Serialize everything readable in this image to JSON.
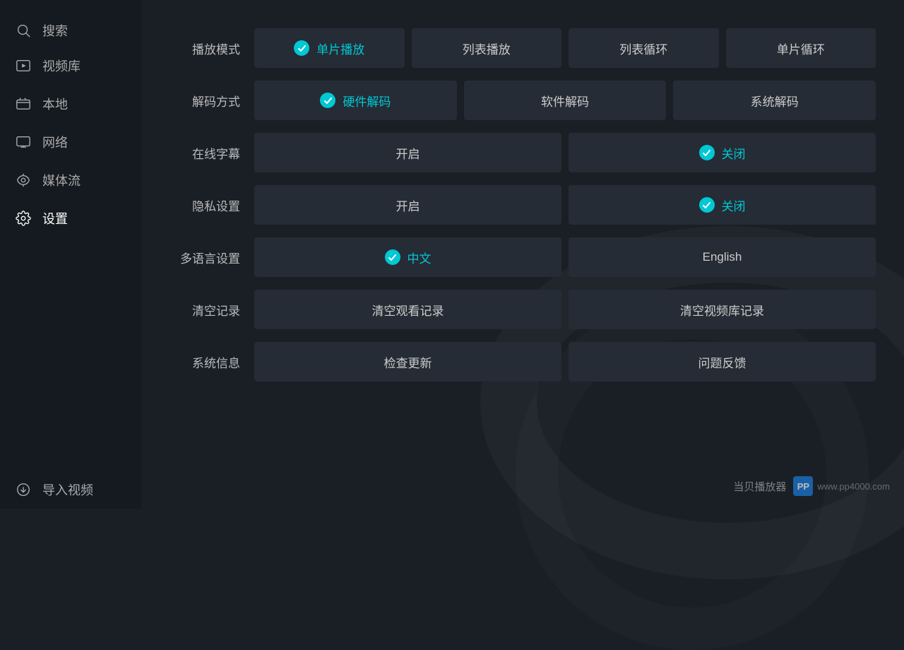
{
  "sidebar": {
    "items": [
      {
        "id": "search",
        "label": "搜索",
        "icon": "search"
      },
      {
        "id": "video-library",
        "label": "视频库",
        "icon": "video-library"
      },
      {
        "id": "local",
        "label": "本地",
        "icon": "local"
      },
      {
        "id": "network",
        "label": "网络",
        "icon": "network"
      },
      {
        "id": "media-stream",
        "label": "媒体流",
        "icon": "media-stream"
      },
      {
        "id": "settings",
        "label": "设置",
        "icon": "settings",
        "active": true
      },
      {
        "id": "import",
        "label": "导入视频",
        "icon": "import"
      }
    ]
  },
  "settings": {
    "playback_mode": {
      "label": "播放模式",
      "options": [
        {
          "id": "single",
          "label": "单片播放",
          "selected": true
        },
        {
          "id": "list",
          "label": "列表播放",
          "selected": false
        },
        {
          "id": "list-loop",
          "label": "列表循环",
          "selected": false
        },
        {
          "id": "single-loop",
          "label": "单片循环",
          "selected": false
        }
      ]
    },
    "decode_mode": {
      "label": "解码方式",
      "options": [
        {
          "id": "hardware",
          "label": "硬件解码",
          "selected": true
        },
        {
          "id": "software",
          "label": "软件解码",
          "selected": false
        },
        {
          "id": "system",
          "label": "系统解码",
          "selected": false
        }
      ]
    },
    "online_subtitle": {
      "label": "在线字幕",
      "options": [
        {
          "id": "on",
          "label": "开启",
          "selected": false
        },
        {
          "id": "off",
          "label": "关闭",
          "selected": true
        }
      ]
    },
    "privacy": {
      "label": "隐私设置",
      "options": [
        {
          "id": "on",
          "label": "开启",
          "selected": false
        },
        {
          "id": "off",
          "label": "关闭",
          "selected": true
        }
      ]
    },
    "language": {
      "label": "多语言设置",
      "options": [
        {
          "id": "zh",
          "label": "中文",
          "selected": true
        },
        {
          "id": "en",
          "label": "English",
          "selected": false
        }
      ]
    },
    "clear_records": {
      "label": "清空记录",
      "options": [
        {
          "id": "clear-watch",
          "label": "清空观看记录",
          "selected": false
        },
        {
          "id": "clear-library",
          "label": "清空视频库记录",
          "selected": false
        }
      ]
    },
    "system_info": {
      "label": "系统信息",
      "options": [
        {
          "id": "check-update",
          "label": "检查更新",
          "selected": false
        },
        {
          "id": "feedback",
          "label": "问题反馈",
          "selected": false
        }
      ]
    }
  },
  "watermark": {
    "brand": "当贝播放器",
    "site": "www.pp4000.com",
    "logo_text": "PP"
  }
}
